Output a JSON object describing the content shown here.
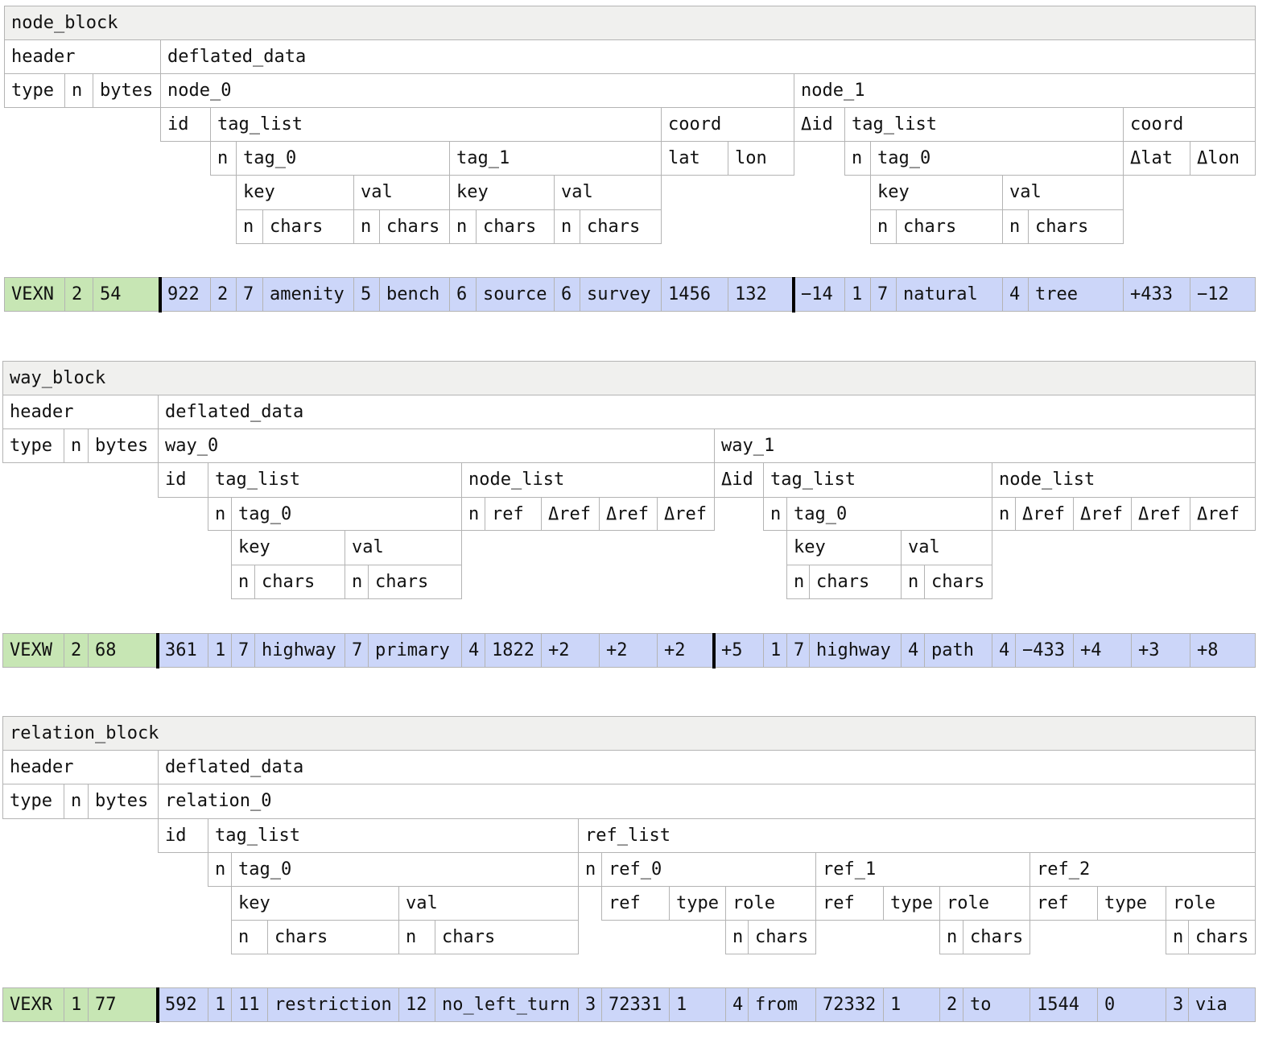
{
  "colors": {
    "header_bytes": "#c7e6b4",
    "data_bytes": "#ccd6f9",
    "title_bg": "#f0f0ee",
    "border": "#b4b4b4"
  },
  "node_block": {
    "title": "node_block",
    "header": "header",
    "deflated": "deflated_data",
    "type": "type",
    "n": "n",
    "bytes": "bytes",
    "node_0": {
      "name": "node_0",
      "id": "id",
      "tag_list": "tag_list",
      "n": "n",
      "tag_0": {
        "name": "tag_0",
        "key": "key",
        "val": "val",
        "key_n": "n",
        "key_chars": "chars",
        "val_n": "n",
        "val_chars": "chars"
      },
      "tag_1": {
        "name": "tag_1",
        "key": "key",
        "val": "val",
        "key_n": "n",
        "key_chars": "chars",
        "val_n": "n",
        "val_chars": "chars"
      },
      "coord": "coord",
      "lat": "lat",
      "lon": "lon"
    },
    "node_1": {
      "name": "node_1",
      "did": "Δid",
      "tag_list": "tag_list",
      "n": "n",
      "tag_0": {
        "name": "tag_0",
        "key": "key",
        "val": "val",
        "key_n": "n",
        "key_chars": "chars",
        "val_n": "n",
        "val_chars": "chars"
      },
      "coord": "coord",
      "dlat": "Δlat",
      "dlon": "Δlon"
    },
    "values": {
      "type": "VEXN",
      "n": "2",
      "bytes": "54",
      "id0": "922",
      "tagn0": "2",
      "t0kn": "7",
      "t0k": "amenity",
      "t0vn": "5",
      "t0v": "bench",
      "t1kn": "6",
      "t1k": "source",
      "t1vn": "6",
      "t1v": "survey",
      "lat": "1456",
      "lon": "132",
      "did1": "−14",
      "tagn1": "1",
      "n1kn": "7",
      "n1k": "natural",
      "n1vn": "4",
      "n1v": "tree",
      "dlat": "+433",
      "dlon": "−12"
    }
  },
  "way_block": {
    "title": "way_block",
    "header": "header",
    "deflated": "deflated_data",
    "type": "type",
    "n": "n",
    "bytes": "bytes",
    "way_0": {
      "name": "way_0",
      "id": "id",
      "tag_list": "tag_list",
      "node_list": "node_list",
      "tl_n": "n",
      "tag_0": "tag_0",
      "key": "key",
      "val": "val",
      "key_n": "n",
      "key_chars": "chars",
      "val_n": "n",
      "val_chars": "chars",
      "nl_n": "n",
      "ref": "ref",
      "dref1": "Δref",
      "dref2": "Δref",
      "dref3": "Δref"
    },
    "way_1": {
      "name": "way_1",
      "did": "Δid",
      "tag_list": "tag_list",
      "node_list": "node_list",
      "tl_n": "n",
      "tag_0": "tag_0",
      "key": "key",
      "val": "val",
      "key_n": "n",
      "key_chars": "chars",
      "val_n": "n",
      "val_chars": "chars",
      "nl_n": "n",
      "dref1": "Δref",
      "dref2": "Δref",
      "dref3": "Δref",
      "dref4": "Δref"
    },
    "values": {
      "type": "VEXW",
      "n": "2",
      "bytes": "68",
      "id0": "361",
      "tagn0": "1",
      "kn0": "7",
      "k0": "highway",
      "vn0": "7",
      "v0": "primary",
      "nln0": "4",
      "ref0": "1822",
      "d0a": "+2",
      "d0b": "+2",
      "d0c": "+2",
      "did1": "+5",
      "tagn1": "1",
      "kn1": "7",
      "k1": "highway",
      "vn1": "4",
      "v1": "path",
      "nln1": "4",
      "d1a": "−433",
      "d1b": "+4",
      "d1c": "+3",
      "d1d": "+8"
    }
  },
  "relation_block": {
    "title": "relation_block",
    "header": "header",
    "deflated": "deflated_data",
    "type": "type",
    "n": "n",
    "bytes": "bytes",
    "relation_0": {
      "name": "relation_0",
      "id": "id",
      "tag_list": "tag_list",
      "ref_list": "ref_list",
      "tl_n": "n",
      "tag_0": "tag_0",
      "key": "key",
      "val": "val",
      "key_n": "n",
      "key_chars": "chars",
      "val_n": "n",
      "val_chars": "chars",
      "rl_n": "n",
      "ref_0": {
        "name": "ref_0",
        "ref": "ref",
        "type": "type",
        "role": "role",
        "role_n": "n",
        "role_chars": "chars"
      },
      "ref_1": {
        "name": "ref_1",
        "ref": "ref",
        "type": "type",
        "role": "role",
        "role_n": "n",
        "role_chars": "chars"
      },
      "ref_2": {
        "name": "ref_2",
        "ref": "ref",
        "type": "type",
        "role": "role",
        "role_n": "n",
        "role_chars": "chars"
      }
    },
    "values": {
      "type": "VEXR",
      "n": "1",
      "bytes": "77",
      "id0": "592",
      "tagn": "1",
      "kn": "11",
      "k": "restriction",
      "vn": "12",
      "v": "no_left_turn",
      "refn": "3",
      "r0ref": "72331",
      "r0type": "1",
      "r0n": "4",
      "r0role": "from",
      "r1ref": "72332",
      "r1type": "1",
      "r1n": "2",
      "r1role": "to",
      "r2ref": "1544",
      "r2type": "0",
      "r2n": "3",
      "r2role": "via"
    }
  }
}
